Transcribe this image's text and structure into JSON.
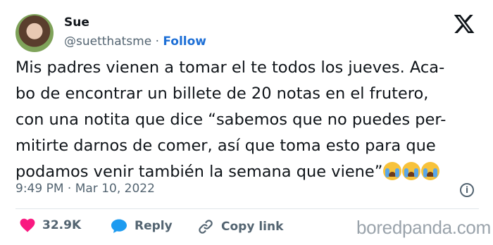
{
  "user": {
    "name": "Sue",
    "handle": "@suetthatsme",
    "separator": "·",
    "follow_label": "Follow"
  },
  "tweet": {
    "lines": [
      "Mis padres vienen a tomar el te todos los jueves. Aca-",
      "bo de encontrar un billete de 20 notas en el frutero,",
      "con una notita que dice “sabemos que no puedes per-",
      "mitirte darnos de comer, así que toma esto para que",
      "podamos venir también la semana que viene”"
    ],
    "emojis": [
      "loudly-crying-face",
      "loudly-crying-face",
      "loudly-crying-face"
    ],
    "timestamp": "9:49 PM · Mar 10, 2022"
  },
  "actions": {
    "like_count": "32.9K",
    "reply_label": "Reply",
    "copy_link_label": "Copy link"
  },
  "watermark": "boredpanda.com",
  "colors": {
    "like": "#f91880",
    "reply": "#1d9bf0",
    "follow": "#1d6fd6",
    "muted": "#536471"
  }
}
